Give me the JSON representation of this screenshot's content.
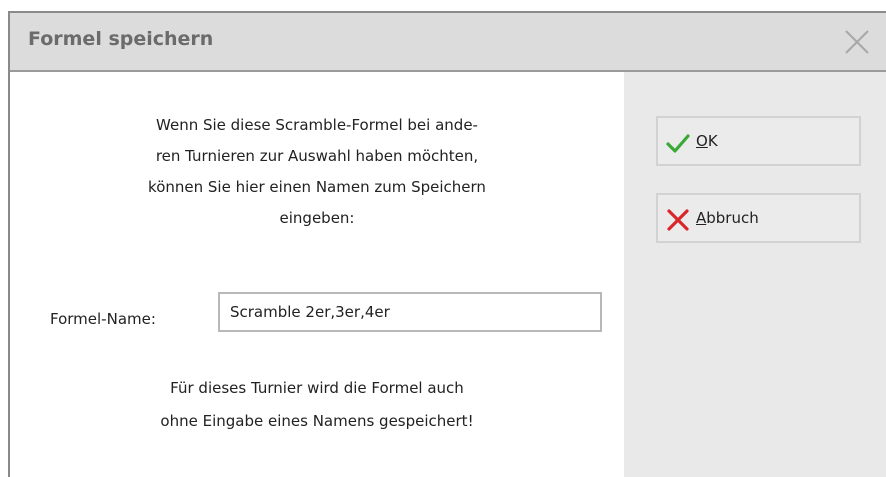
{
  "dialog": {
    "title": "Formel speichern",
    "intro_lines": [
      "Wenn Sie diese Scramble-Formel bei ande-",
      "ren Turnieren zur Auswahl haben möchten,",
      "können Sie hier einen Namen zum Speichern",
      "eingeben:"
    ],
    "formula_name_label": "Formel-Name:",
    "formula_name_value": "Scramble 2er,3er,4er",
    "note_lines": [
      "Für dieses Turnier wird die Formel auch",
      "ohne Eingabe eines Namens gespeichert!"
    ]
  },
  "buttons": {
    "ok": {
      "mnemonic": "O",
      "rest": "K",
      "icon": "checkmark-icon",
      "icon_color": "#3aa935"
    },
    "cancel": {
      "mnemonic": "A",
      "rest": "bbruch",
      "icon": "cross-icon",
      "icon_color": "#d8262b"
    }
  }
}
